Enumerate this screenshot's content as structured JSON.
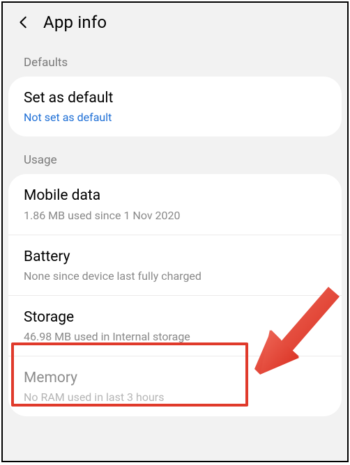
{
  "header": {
    "title": "App info"
  },
  "sections": {
    "defaults": {
      "label": "Defaults",
      "set_default": {
        "title": "Set as default",
        "subtitle": "Not set as default"
      }
    },
    "usage": {
      "label": "Usage",
      "mobile_data": {
        "title": "Mobile data",
        "subtitle": "1.86 MB used since 1 Nov 2020"
      },
      "battery": {
        "title": "Battery",
        "subtitle": "None since device last fully charged"
      },
      "storage": {
        "title": "Storage",
        "subtitle": "46.98 MB used in Internal storage"
      },
      "memory": {
        "title": "Memory",
        "subtitle": "No RAM used in last 3 hours"
      }
    }
  },
  "annotation": {
    "highlight_target": "storage",
    "arrow_color": "#e03a2b"
  }
}
